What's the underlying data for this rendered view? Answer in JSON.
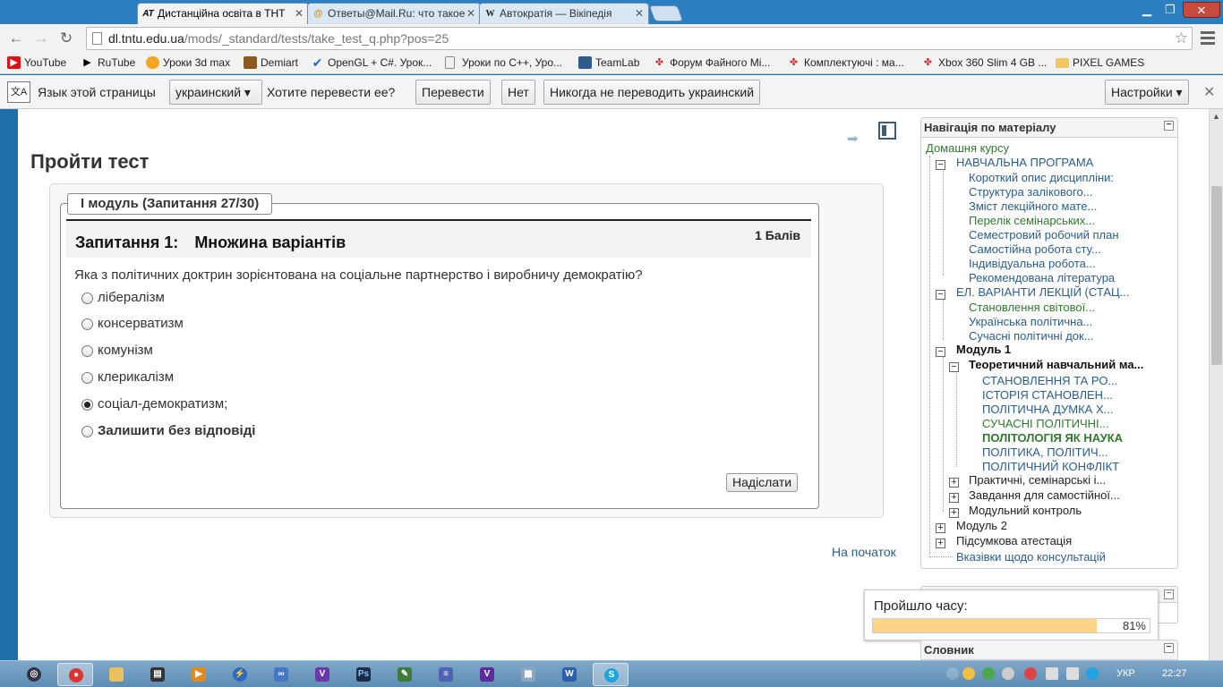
{
  "tabs": [
    {
      "title": "Дистанційна освіта в ТНТ",
      "favicon": "AT",
      "active": true
    },
    {
      "title": "Ответы@Mail.Ru: что такое",
      "favicon": "@",
      "active": false
    },
    {
      "title": "Автократія — Вікіпедія",
      "favicon": "W",
      "active": false
    }
  ],
  "url": {
    "host": "dl.tntu.edu.ua",
    "path": "/mods/_standard/tests/take_test_q.php?pos=25"
  },
  "bookmarks": [
    "YouTube",
    "RuTube",
    "Уроки 3d max",
    "Demiart",
    "OpenGL + C#. Урок...",
    "Уроки по C++, Уро...",
    "TeamLab",
    "Форум Файного Мі...",
    "Комплектуючі : ма...",
    "Xbox 360 Slim 4 GB ...",
    "PIXEL GAMES"
  ],
  "translate_bar": {
    "page_language_label": "Язык этой страницы",
    "language": "украинский",
    "question": "Хотите перевести ее?",
    "translate_btn": "Перевести",
    "no_btn": "Нет",
    "never_btn": "Никогда не переводить украинский",
    "settings_btn": "Настройки"
  },
  "page": {
    "title": "Пройти тест",
    "module_legend": "I модуль (Запитання 27/30)",
    "question_number": "Запитання 1:",
    "question_type": "Множина варіантів",
    "points": "1 Балів",
    "question_text": "Яка з політичних доктрин зорієнтована на соціальне партнерство і виробничу демократію?",
    "options": [
      {
        "label": "лібералізм",
        "checked": false
      },
      {
        "label": "консерватизм",
        "checked": false
      },
      {
        "label": "комунізм",
        "checked": false
      },
      {
        "label": "клерикалізм",
        "checked": false
      },
      {
        "label": "соціал-демократизм;",
        "checked": true
      },
      {
        "label": "Залишити без відповіді",
        "checked": false
      }
    ],
    "submit": "Надіслати",
    "to_top": "На початок"
  },
  "nav_block": {
    "title": "Навігація по матеріалу",
    "collapse": "−",
    "home": "Домашня курсу",
    "items": [
      {
        "label": "НАВЧАЛЬНА ПРОГРАМА",
        "style": "normal"
      },
      {
        "label": "Короткий опис дисципліни:",
        "style": "normal"
      },
      {
        "label": "Структура залікового...",
        "style": "normal"
      },
      {
        "label": "Зміст лекційного мате...",
        "style": "normal"
      },
      {
        "label": "Перелік семінарських...",
        "style": "green"
      },
      {
        "label": "Семестровий робочий план",
        "style": "normal"
      },
      {
        "label": "Самостійна робота сту...",
        "style": "normal"
      },
      {
        "label": "Індивідуальна робота...",
        "style": "normal"
      },
      {
        "label": "Рекомендована література",
        "style": "normal"
      },
      {
        "label": "ЕЛ. ВАРІАНТИ ЛЕКЦІЙ (СТАЦ...",
        "style": "normal"
      },
      {
        "label": "Становлення світової...",
        "style": "green"
      },
      {
        "label": "Українська політична...",
        "style": "normal"
      },
      {
        "label": "Сучасні політичні док...",
        "style": "normal"
      },
      {
        "label": "Модуль 1",
        "style": "bold"
      },
      {
        "label": "Теоретичний навчальний ма...",
        "style": "bold"
      },
      {
        "label": "СТАНОВЛЕННЯ ТА РО...",
        "style": "normal"
      },
      {
        "label": "ІСТОРІЯ СТАНОВЛЕН...",
        "style": "normal"
      },
      {
        "label": "ПОЛІТИЧНА ДУМКА Х...",
        "style": "normal"
      },
      {
        "label": "СУЧАСНІ ПОЛІТИЧНІ...",
        "style": "green"
      },
      {
        "label": "ПОЛІТОЛОГІЯ ЯК НАУКА",
        "style": "current"
      },
      {
        "label": "ПОЛІТИКА, ПОЛІТИЧ...",
        "style": "normal"
      },
      {
        "label": "ПОЛІТИЧНИЙ КОНФЛІКТ",
        "style": "normal"
      },
      {
        "label": "Практичні, семінарські і...",
        "style": "dark"
      },
      {
        "label": "Завдання для самостійної...",
        "style": "dark"
      },
      {
        "label": "Модульний контроль",
        "style": "dark"
      },
      {
        "label": "Модуль 2",
        "style": "dark"
      },
      {
        "label": "Підсумкова атестація",
        "style": "dark"
      },
      {
        "label": "Вказівки щодо консультацій",
        "style": "normal"
      }
    ]
  },
  "timer": {
    "label": "Пройшло часу:",
    "percent_text": "81%",
    "fraction": 0.81
  },
  "glossary": {
    "title": "Словник"
  },
  "taskbar": {
    "language": "УКР",
    "time": "22:27"
  },
  "colors": {
    "accent": "#2a5d8a",
    "visited": "#2f7a2f",
    "timer_fill": "#fdd586"
  }
}
